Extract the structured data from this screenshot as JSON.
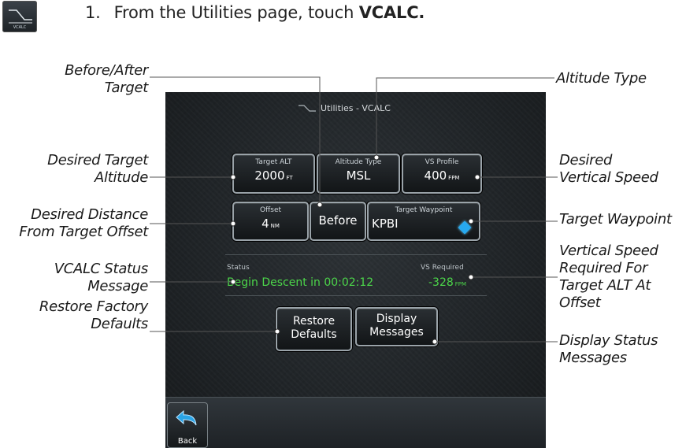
{
  "instruction": {
    "icon_label": "VCALC",
    "step_number": "1.",
    "text_prefix": "From the Utilities page, touch ",
    "text_bold": "VCALC."
  },
  "callouts": {
    "before_after_target": [
      "Before/After",
      "Target"
    ],
    "altitude_type": [
      "Altitude Type"
    ],
    "desired_target_altitude": [
      "Desired Target",
      "Altitude"
    ],
    "desired_vertical_speed": [
      "Desired",
      "Vertical Speed"
    ],
    "desired_distance_offset": [
      "Desired Distance",
      "From Target Offset"
    ],
    "target_waypoint": [
      "Target Waypoint"
    ],
    "vcalc_status_message": [
      "VCALC Status",
      "Message"
    ],
    "vs_required": [
      "Vertical Speed",
      "Required For",
      "Target ALT At",
      "Offset"
    ],
    "restore_factory_defaults": [
      "Restore Factory",
      "Defaults"
    ],
    "display_status_messages": [
      "Display Status",
      "Messages"
    ]
  },
  "screen": {
    "title": "Utilities - VCALC",
    "target_alt": {
      "label": "Target ALT",
      "value": "2000",
      "unit": "FT"
    },
    "altitude_type": {
      "label": "Altitude Type",
      "value": "MSL"
    },
    "vs_profile": {
      "label": "VS Profile",
      "value": "400",
      "unit": "FPM"
    },
    "offset": {
      "label": "Offset",
      "value": "4",
      "unit": "NM"
    },
    "before_button": "Before",
    "target_waypoint": {
      "label": "Target Waypoint",
      "value": "KPBI",
      "icon": "waypoint-diamond-icon",
      "icon_color": "#27a9ef"
    },
    "status": {
      "label": "Status",
      "message": "Begin Descent in 00:02:12",
      "color": "#4cd64a"
    },
    "vs_required": {
      "label": "VS Required",
      "value": "-328",
      "unit": "FPM"
    },
    "restore_defaults": [
      "Restore",
      "Defaults"
    ],
    "display_messages": [
      "Display",
      "Messages"
    ],
    "back_label": "Back"
  }
}
